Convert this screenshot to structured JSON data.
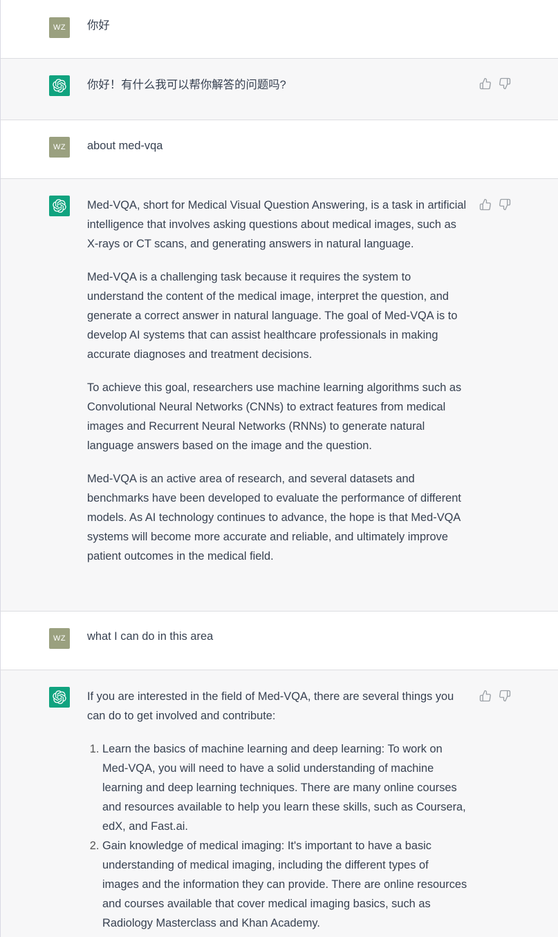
{
  "user_initials": "WZ",
  "messages": [
    {
      "role": "user",
      "text": "你好"
    },
    {
      "role": "assistant",
      "text": "你好！有什么我可以帮你解答的问题吗?"
    },
    {
      "role": "user",
      "text": "about med-vqa"
    },
    {
      "role": "assistant",
      "paragraphs": [
        "Med-VQA, short for Medical Visual Question Answering, is a task in artificial intelligence that involves asking questions about medical images, such as X-rays or CT scans, and generating answers in natural language.",
        "Med-VQA is a challenging task because it requires the system to understand the content of the medical image, interpret the question, and generate a correct answer in natural language. The goal of Med-VQA is to develop AI systems that can assist healthcare professionals in making accurate diagnoses and treatment decisions.",
        "To achieve this goal, researchers use machine learning algorithms such as Convolutional Neural Networks (CNNs) to extract features from medical images and Recurrent Neural Networks (RNNs) to generate natural language answers based on the image and the question.",
        "Med-VQA is an active area of research, and several datasets and benchmarks have been developed to evaluate the performance of different models. As AI technology continues to advance, the hope is that Med-VQA systems will become more accurate and reliable, and ultimately improve patient outcomes in the medical field."
      ]
    },
    {
      "role": "user",
      "text": "what I can do in this area"
    },
    {
      "role": "assistant",
      "intro": "If you are interested in the field of Med-VQA, there are several things you can do to get involved and contribute:",
      "list": [
        "Learn the basics of machine learning and deep learning: To work on Med-VQA, you will need to have a solid understanding of machine learning and deep learning techniques. There are many online courses and resources available to help you learn these skills, such as Coursera, edX, and Fast.ai.",
        "Gain knowledge of medical imaging: It's important to have a basic understanding of medical imaging, including the different types of images and the information they can provide. There are online resources and courses available that cover medical imaging basics, such as Radiology Masterclass and Khan Academy."
      ]
    }
  ],
  "icons": {
    "assistant_avatar": "openai-logo-icon",
    "thumbs_up": "thumbs-up-icon",
    "thumbs_down": "thumbs-down-icon"
  },
  "colors": {
    "assistant_avatar_bg": "#10a37f",
    "user_avatar_bg": "#9aa07f",
    "assistant_row_bg": "#f7f7f8",
    "user_row_bg": "#ffffff",
    "text": "#374151"
  }
}
